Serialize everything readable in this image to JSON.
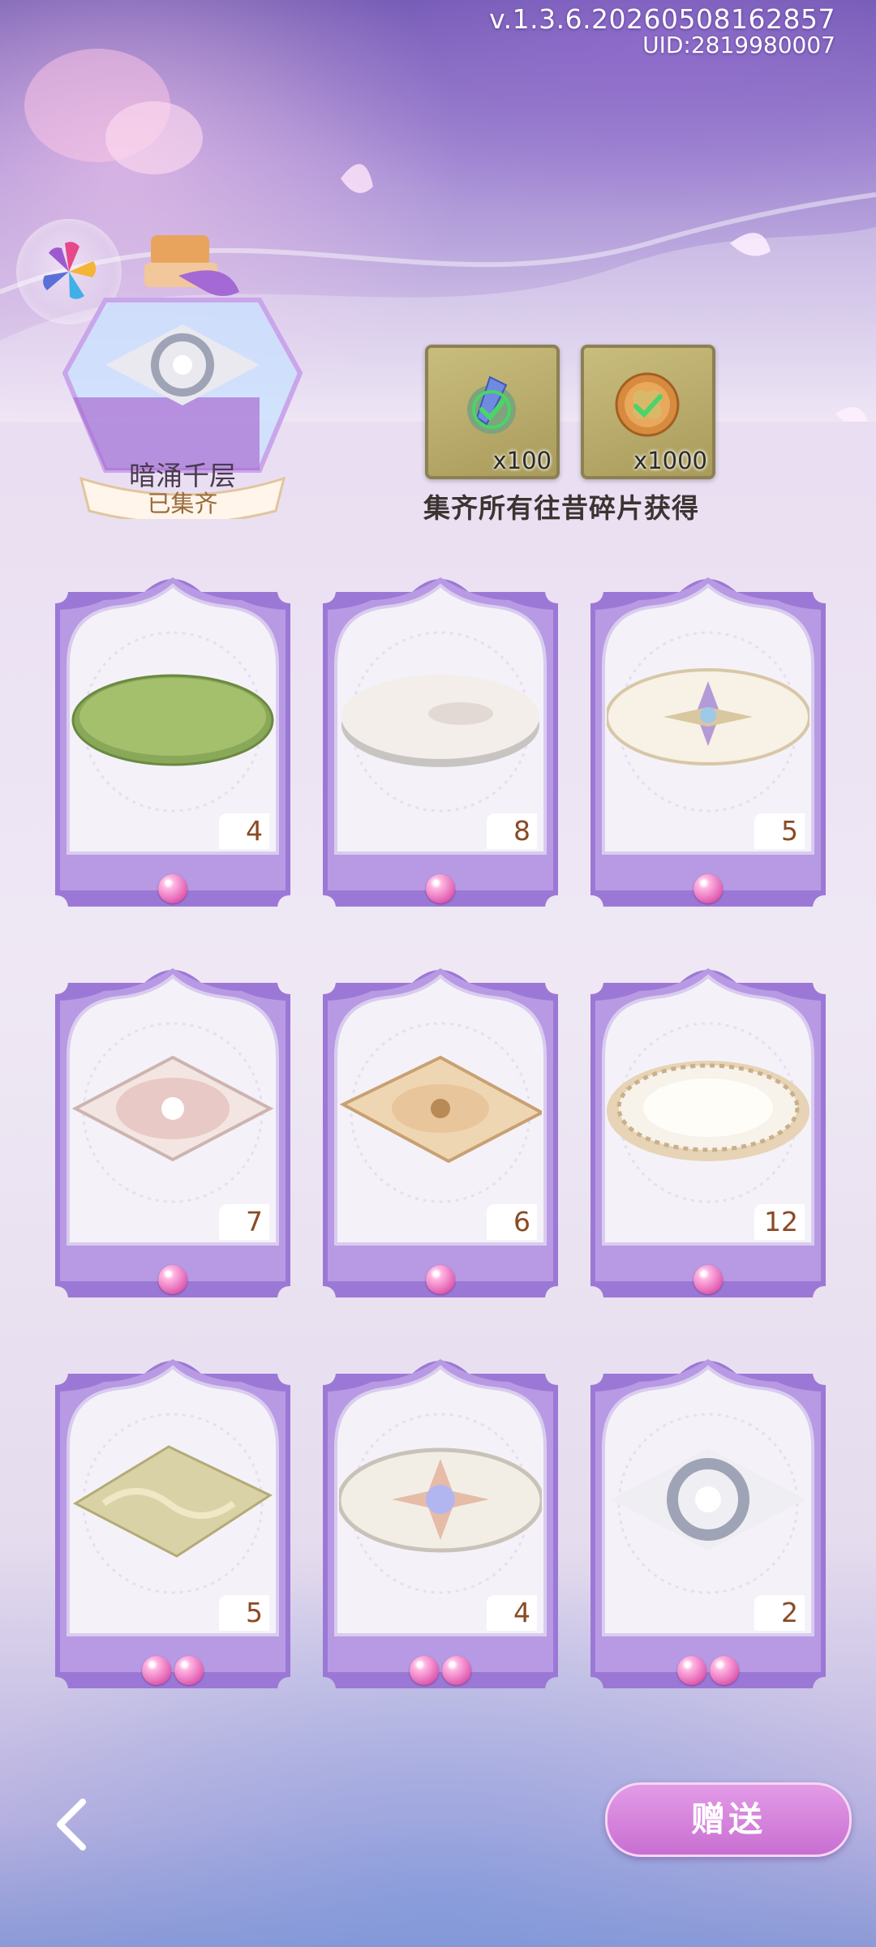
{
  "header": {
    "version": "v.1.3.6.20260508162857",
    "uid": "UID:2819980007"
  },
  "collection": {
    "name": "暗涌千层",
    "status": "已集齐"
  },
  "rewards": {
    "items": [
      {
        "icon": "crystal-feather-icon",
        "count": "x100"
      },
      {
        "icon": "clover-coin-icon",
        "count": "x1000"
      }
    ],
    "caption": "集齐所有往昔碎片获得"
  },
  "cards": [
    {
      "art": "green-oval-rug",
      "count": "4",
      "pearls": 1
    },
    {
      "art": "white-round-platform",
      "count": "8",
      "pearls": 1
    },
    {
      "art": "compass-round-rug",
      "count": "5",
      "pearls": 1
    },
    {
      "art": "pink-diamond-rug",
      "count": "7",
      "pearls": 1
    },
    {
      "art": "gold-ornate-rug",
      "count": "6",
      "pearls": 1
    },
    {
      "art": "floral-oval-rug",
      "count": "12",
      "pearls": 1
    },
    {
      "art": "gold-marble-rug",
      "count": "5",
      "pearls": 2
    },
    {
      "art": "star-round-rug",
      "count": "4",
      "pearls": 2
    },
    {
      "art": "stone-diamond-rug",
      "count": "2",
      "pearls": 2
    }
  ],
  "footer": {
    "gift_label": "赠送"
  }
}
